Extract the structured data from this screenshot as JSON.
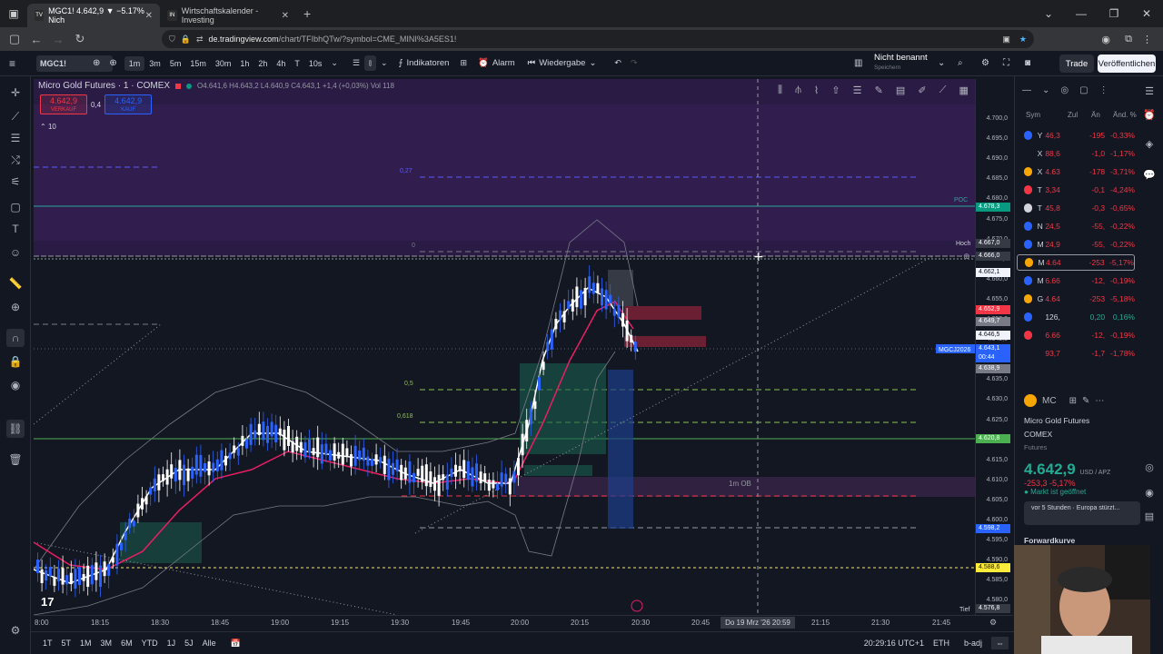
{
  "browser": {
    "tabs": [
      {
        "label": "MGC1! 4.642,9 ▼ −5.17% Nich",
        "active": true
      },
      {
        "label": "Wirtschaftskalender - Investing",
        "active": false
      }
    ],
    "url_host": "de.tradingview.com",
    "url_path": "/chart/TFIbhQTw/?symbol=CME_MINI%3A5ES1!"
  },
  "toolbar": {
    "symbol": "MGC1!",
    "timeframes": [
      "1m",
      "3m",
      "5m",
      "15m",
      "30m",
      "1h",
      "2h",
      "4h",
      "T",
      "10s"
    ],
    "selected_timeframe": "1m",
    "indicators_label": "Indikatoren",
    "alarm_label": "Alarm",
    "replay_label": "Wiedergabe",
    "layout_name": "Nicht benannt",
    "layout_sub": "Speichern",
    "trade_label": "Trade",
    "publish_label": "Veröffentlichen"
  },
  "legend": {
    "title": "Micro Gold Futures · 1 · COMEX",
    "ohlc": "O4.641,6 H4.643,2 L4.640,9 C4.643,1 +1,4 (+0,03%) Vol 118",
    "sell_price": "4.642,9",
    "sell_label": "VERKAUF",
    "spread": "0,4",
    "buy_price": "4.642,9",
    "buy_label": "KAUF",
    "indicator_count": "10"
  },
  "price_axis": {
    "ticks": [
      "4.700,0",
      "4.695,0",
      "4.690,0",
      "4.685,0",
      "4.680,0",
      "4.675,0",
      "4.670,0",
      "4.665,0",
      "4.660,0",
      "4.655,0",
      "4.650,0",
      "4.645,0",
      "4.640,0",
      "4.635,0",
      "4.630,0",
      "4.625,0",
      "4.620,0",
      "4.615,0",
      "4.610,0",
      "4.605,0",
      "4.600,0",
      "4.595,0",
      "4.590,0",
      "4.585,0",
      "4.580,0"
    ],
    "tags": [
      {
        "text": "4.678,3",
        "color": "#089981"
      },
      {
        "text": "4.667,0",
        "color": "#363a45"
      },
      {
        "text": "4.666,0",
        "color": "#363a45"
      },
      {
        "text": "4.662,1",
        "color": "#f0f3fa"
      },
      {
        "text": "4.652,9",
        "color": "#f23645"
      },
      {
        "text": "4.649,7",
        "color": "#787b86"
      },
      {
        "text": "4.646,5",
        "color": "#f0f3fa"
      },
      {
        "text": "4.643,1",
        "color": "#2962ff"
      },
      {
        "text": "00:44",
        "color": "#2962ff"
      },
      {
        "text": "4.638,9",
        "color": "#787b86"
      },
      {
        "text": "4.620,8",
        "color": "#4caf50"
      },
      {
        "text": "4.598,2",
        "color": "#2962ff"
      },
      {
        "text": "4.588,6",
        "color": "#ffeb3b"
      },
      {
        "text": "4.576,8",
        "color": "#363a45"
      }
    ],
    "labels": {
      "poc": "POC",
      "high": "Hoch",
      "low": "Tief",
      "contract": "MGCJ2026"
    }
  },
  "chart_labels": {
    "fib_027": "0,27",
    "fib_0": "0",
    "fib_05": "0,5",
    "fib_0618": "0,618",
    "ob": "1m OB"
  },
  "time_axis": {
    "ticks": [
      "8:00",
      "18:15",
      "18:30",
      "18:45",
      "19:00",
      "19:15",
      "19:30",
      "19:45",
      "20:00",
      "20:15",
      "20:30",
      "20:45",
      "21:15",
      "21:30",
      "21:45"
    ],
    "crosshair_date": "Do 19 Mrz '26   20:59"
  },
  "bottom": {
    "ranges": [
      "1T",
      "5T",
      "1M",
      "3M",
      "6M",
      "YTD",
      "1J",
      "5J",
      "Alle"
    ],
    "clock": "20:29:16 UTC+1",
    "session": "ETH",
    "adj": "b-adj"
  },
  "watchlist": {
    "headers": [
      "Sym",
      "Zul",
      "Än",
      "Änd. %"
    ],
    "rows": [
      {
        "s": "Y",
        "v": "46,3",
        "c": "-195",
        "p": "-0,33%",
        "color": "#2962ff"
      },
      {
        "s": "X",
        "v": "88,6",
        "c": "-1,0",
        "p": "-1,17%",
        "color": "#131722"
      },
      {
        "s": "X",
        "v": "4.63",
        "c": "-178",
        "p": "-3,71%",
        "color": "#f7a600"
      },
      {
        "s": "T",
        "v": "3,34",
        "c": "-0,1",
        "p": "-4,24%",
        "color": "#f23645"
      },
      {
        "s": "T",
        "v": "45,8",
        "c": "-0,3",
        "p": "-0,65%",
        "color": "#d1d4dc"
      },
      {
        "s": "N",
        "v": "24,5",
        "c": "-55,",
        "p": "-0,22%",
        "color": "#2962ff"
      },
      {
        "s": "M",
        "v": "24,9",
        "c": "-55,",
        "p": "-0,22%",
        "color": "#2962ff"
      },
      {
        "s": "M",
        "v": "4.64",
        "c": "-253",
        "p": "-5,17%",
        "color": "#f7a600"
      },
      {
        "s": "M",
        "v": "6.66",
        "c": "-12,",
        "p": "-0,19%",
        "color": "#2962ff"
      },
      {
        "s": "G",
        "v": "4.64",
        "c": "-253",
        "p": "-5,18%",
        "color": "#f7a600"
      },
      {
        "s": "",
        "v": "126,",
        "c": "0,20",
        "p": "0,16%",
        "color": "#2962ff"
      },
      {
        "s": "",
        "v": "6.66",
        "c": "-12,",
        "p": "-0,19%",
        "color": "#f23645"
      },
      {
        "s": "",
        "v": "93,7",
        "c": "-1,7",
        "p": "-1,78%",
        "color": "#131722"
      }
    ]
  },
  "detail": {
    "short": "MC",
    "name": "Micro Gold Futures",
    "exchange": "COMEX",
    "type": "Futures",
    "price": "4.642,9",
    "currency": "USD / APZ",
    "change": "-253,3  -5,17%",
    "status": "Markt ist geöffnet",
    "news": "vor 5 Stunden · Europa stürzt...",
    "forward": "Forwardkurve"
  },
  "colors": {
    "up": "#2962ff",
    "down": "#ffffff",
    "accent": "#2962ff",
    "neg": "#f23645",
    "pos": "#22ab94"
  }
}
